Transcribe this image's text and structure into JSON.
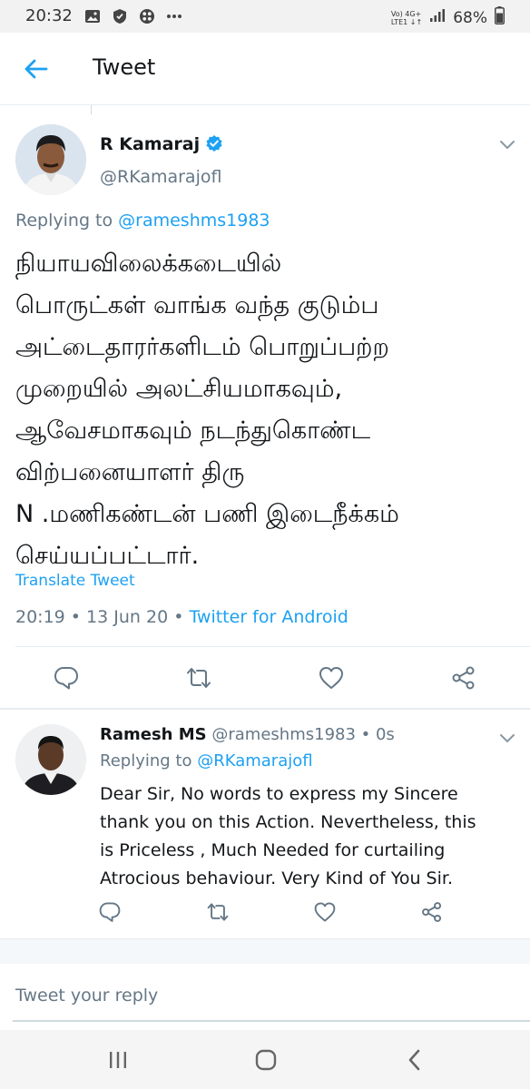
{
  "status_bar": {
    "time": "20:32",
    "network_top": "Vo) 4G+",
    "network_bottom": "LTE1 ↓↑",
    "battery": "68%",
    "icons": [
      "gallery-icon",
      "shield-check-icon",
      "app-grid-icon",
      "more-dots-icon"
    ]
  },
  "header": {
    "title": "Tweet"
  },
  "main_tweet": {
    "author_name": "R Kamaraj",
    "handle": "@RKamarajofl",
    "replying_prefix": "Replying to ",
    "replying_to": "@rameshms1983",
    "text_lines": [
      "நியாயவிலைக்கடையில்",
      "பொருட்கள் வாங்க வந்த குடும்ப",
      "அட்டைதாரர்களிடம் பொறுப்பற்ற",
      "முறையில் அலட்சியமாகவும்,",
      "ஆவேசமாகவும் நடந்துகொண்ட",
      "விற்பனையாளர்  திரு",
      "N .மணிகண்டன் பணி  இடைநீக்கம்",
      "செய்யப்பட்டார்."
    ],
    "translate_label": "Translate Tweet",
    "timestamp": "20:19 • 13 Jun 20 • ",
    "source": "Twitter for Android"
  },
  "reply_tweet": {
    "author_name": "Ramesh MS",
    "handle_time": " @rameshms1983 • 0s",
    "replying_prefix": "Replying to ",
    "replying_to": "@RKamarajofl",
    "text_lines": [
      "Dear Sir, No words to express my Sincere",
      "thank you on this Action. Nevertheless, this",
      "is Priceless , Much Needed for curtailing",
      "Atrocious behaviour. Very Kind of You Sir."
    ]
  },
  "reply_box": {
    "placeholder": "Tweet your reply"
  },
  "colors": {
    "accent": "#1da1f2",
    "secondary_text": "#657786",
    "primary_text": "#14171a",
    "divider": "#e6ecf0"
  }
}
